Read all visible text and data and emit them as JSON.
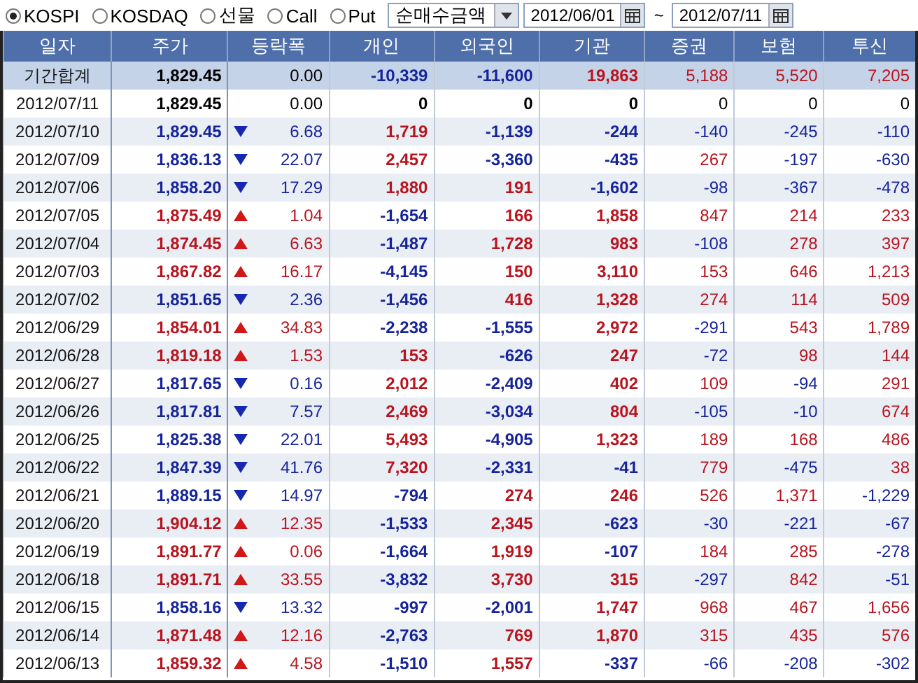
{
  "market_options": [
    {
      "label": "KOSPI",
      "selected": true
    },
    {
      "label": "KOSDAQ",
      "selected": false
    },
    {
      "label": "선물",
      "selected": false
    },
    {
      "label": "Call",
      "selected": false
    },
    {
      "label": "Put",
      "selected": false
    }
  ],
  "measure_dropdown": {
    "value": "순매수금액"
  },
  "date_from": {
    "value": "2012/06/01"
  },
  "range_separator": "~",
  "date_to": {
    "value": "2012/07/11"
  },
  "table": {
    "columns": [
      "일자",
      "주가",
      "등락폭",
      "개인",
      "외국인",
      "기관",
      "증권",
      "보험",
      "투신"
    ],
    "rows": [
      {
        "summary": true,
        "cells": [
          {
            "text": "기간합계"
          },
          {
            "text": "1,829.45",
            "color": "#000000"
          },
          {
            "text": "0.00",
            "color": "#000000",
            "rising": false,
            "falling": false
          },
          {
            "text": "-10,339",
            "color": "#16249a"
          },
          {
            "text": "-11,600",
            "color": "#16249a"
          },
          {
            "text": "19,863",
            "color": "#b8141e"
          },
          {
            "text": "5,188",
            "color": "#b8141e"
          },
          {
            "text": "5,520",
            "color": "#b8141e"
          },
          {
            "text": "7,205",
            "color": "#b8141e"
          }
        ]
      },
      {
        "summary": false,
        "cells": [
          {
            "text": "2012/07/11"
          },
          {
            "text": "1,829.45",
            "color": "#000000"
          },
          {
            "text": "0.00",
            "color": "#000000",
            "rising": false,
            "falling": false
          },
          {
            "text": "0",
            "color": "#000000"
          },
          {
            "text": "0",
            "color": "#000000"
          },
          {
            "text": "0",
            "color": "#000000"
          },
          {
            "text": "0",
            "color": "#000000"
          },
          {
            "text": "0",
            "color": "#000000"
          },
          {
            "text": "0",
            "color": "#000000"
          }
        ]
      },
      {
        "summary": false,
        "cells": [
          {
            "text": "2012/07/10"
          },
          {
            "text": "1,829.45",
            "color": "#16249a"
          },
          {
            "text": "6.68",
            "color": "#16249a",
            "rising": false,
            "falling": true
          },
          {
            "text": "1,719",
            "color": "#b8141e"
          },
          {
            "text": "-1,139",
            "color": "#16249a"
          },
          {
            "text": "-244",
            "color": "#16249a"
          },
          {
            "text": "-140",
            "color": "#16249a"
          },
          {
            "text": "-245",
            "color": "#16249a"
          },
          {
            "text": "-110",
            "color": "#16249a"
          }
        ]
      },
      {
        "summary": false,
        "cells": [
          {
            "text": "2012/07/09"
          },
          {
            "text": "1,836.13",
            "color": "#16249a"
          },
          {
            "text": "22.07",
            "color": "#16249a",
            "rising": false,
            "falling": true
          },
          {
            "text": "2,457",
            "color": "#b8141e"
          },
          {
            "text": "-3,360",
            "color": "#16249a"
          },
          {
            "text": "-435",
            "color": "#16249a"
          },
          {
            "text": "267",
            "color": "#b8141e"
          },
          {
            "text": "-197",
            "color": "#16249a"
          },
          {
            "text": "-630",
            "color": "#16249a"
          }
        ]
      },
      {
        "summary": false,
        "cells": [
          {
            "text": "2012/07/06"
          },
          {
            "text": "1,858.20",
            "color": "#16249a"
          },
          {
            "text": "17.29",
            "color": "#16249a",
            "rising": false,
            "falling": true
          },
          {
            "text": "1,880",
            "color": "#b8141e"
          },
          {
            "text": "191",
            "color": "#b8141e"
          },
          {
            "text": "-1,602",
            "color": "#16249a"
          },
          {
            "text": "-98",
            "color": "#16249a"
          },
          {
            "text": "-367",
            "color": "#16249a"
          },
          {
            "text": "-478",
            "color": "#16249a"
          }
        ]
      },
      {
        "summary": false,
        "cells": [
          {
            "text": "2012/07/05"
          },
          {
            "text": "1,875.49",
            "color": "#b8141e"
          },
          {
            "text": "1.04",
            "color": "#b8141e",
            "rising": true,
            "falling": false
          },
          {
            "text": "-1,654",
            "color": "#16249a"
          },
          {
            "text": "166",
            "color": "#b8141e"
          },
          {
            "text": "1,858",
            "color": "#b8141e"
          },
          {
            "text": "847",
            "color": "#b8141e"
          },
          {
            "text": "214",
            "color": "#b8141e"
          },
          {
            "text": "233",
            "color": "#b8141e"
          }
        ]
      },
      {
        "summary": false,
        "cells": [
          {
            "text": "2012/07/04"
          },
          {
            "text": "1,874.45",
            "color": "#b8141e"
          },
          {
            "text": "6.63",
            "color": "#b8141e",
            "rising": true,
            "falling": false
          },
          {
            "text": "-1,487",
            "color": "#16249a"
          },
          {
            "text": "1,728",
            "color": "#b8141e"
          },
          {
            "text": "983",
            "color": "#b8141e"
          },
          {
            "text": "-108",
            "color": "#16249a"
          },
          {
            "text": "278",
            "color": "#b8141e"
          },
          {
            "text": "397",
            "color": "#b8141e"
          }
        ]
      },
      {
        "summary": false,
        "cells": [
          {
            "text": "2012/07/03"
          },
          {
            "text": "1,867.82",
            "color": "#b8141e"
          },
          {
            "text": "16.17",
            "color": "#b8141e",
            "rising": true,
            "falling": false
          },
          {
            "text": "-4,145",
            "color": "#16249a"
          },
          {
            "text": "150",
            "color": "#b8141e"
          },
          {
            "text": "3,110",
            "color": "#b8141e"
          },
          {
            "text": "153",
            "color": "#b8141e"
          },
          {
            "text": "646",
            "color": "#b8141e"
          },
          {
            "text": "1,213",
            "color": "#b8141e"
          }
        ]
      },
      {
        "summary": false,
        "cells": [
          {
            "text": "2012/07/02"
          },
          {
            "text": "1,851.65",
            "color": "#16249a"
          },
          {
            "text": "2.36",
            "color": "#16249a",
            "rising": false,
            "falling": true
          },
          {
            "text": "-1,456",
            "color": "#16249a"
          },
          {
            "text": "416",
            "color": "#b8141e"
          },
          {
            "text": "1,328",
            "color": "#b8141e"
          },
          {
            "text": "274",
            "color": "#b8141e"
          },
          {
            "text": "114",
            "color": "#b8141e"
          },
          {
            "text": "509",
            "color": "#b8141e"
          }
        ]
      },
      {
        "summary": false,
        "cells": [
          {
            "text": "2012/06/29"
          },
          {
            "text": "1,854.01",
            "color": "#b8141e"
          },
          {
            "text": "34.83",
            "color": "#b8141e",
            "rising": true,
            "falling": false
          },
          {
            "text": "-2,238",
            "color": "#16249a"
          },
          {
            "text": "-1,555",
            "color": "#16249a"
          },
          {
            "text": "2,972",
            "color": "#b8141e"
          },
          {
            "text": "-291",
            "color": "#16249a"
          },
          {
            "text": "543",
            "color": "#b8141e"
          },
          {
            "text": "1,789",
            "color": "#b8141e"
          }
        ]
      },
      {
        "summary": false,
        "cells": [
          {
            "text": "2012/06/28"
          },
          {
            "text": "1,819.18",
            "color": "#b8141e"
          },
          {
            "text": "1.53",
            "color": "#b8141e",
            "rising": true,
            "falling": false
          },
          {
            "text": "153",
            "color": "#b8141e"
          },
          {
            "text": "-626",
            "color": "#16249a"
          },
          {
            "text": "247",
            "color": "#b8141e"
          },
          {
            "text": "-72",
            "color": "#16249a"
          },
          {
            "text": "98",
            "color": "#b8141e"
          },
          {
            "text": "144",
            "color": "#b8141e"
          }
        ]
      },
      {
        "summary": false,
        "cells": [
          {
            "text": "2012/06/27"
          },
          {
            "text": "1,817.65",
            "color": "#16249a"
          },
          {
            "text": "0.16",
            "color": "#16249a",
            "rising": false,
            "falling": true
          },
          {
            "text": "2,012",
            "color": "#b8141e"
          },
          {
            "text": "-2,409",
            "color": "#16249a"
          },
          {
            "text": "402",
            "color": "#b8141e"
          },
          {
            "text": "109",
            "color": "#b8141e"
          },
          {
            "text": "-94",
            "color": "#16249a"
          },
          {
            "text": "291",
            "color": "#b8141e"
          }
        ]
      },
      {
        "summary": false,
        "cells": [
          {
            "text": "2012/06/26"
          },
          {
            "text": "1,817.81",
            "color": "#16249a"
          },
          {
            "text": "7.57",
            "color": "#16249a",
            "rising": false,
            "falling": true
          },
          {
            "text": "2,469",
            "color": "#b8141e"
          },
          {
            "text": "-3,034",
            "color": "#16249a"
          },
          {
            "text": "804",
            "color": "#b8141e"
          },
          {
            "text": "-105",
            "color": "#16249a"
          },
          {
            "text": "-10",
            "color": "#16249a"
          },
          {
            "text": "674",
            "color": "#b8141e"
          }
        ]
      },
      {
        "summary": false,
        "cells": [
          {
            "text": "2012/06/25"
          },
          {
            "text": "1,825.38",
            "color": "#16249a"
          },
          {
            "text": "22.01",
            "color": "#16249a",
            "rising": false,
            "falling": true
          },
          {
            "text": "5,493",
            "color": "#b8141e"
          },
          {
            "text": "-4,905",
            "color": "#16249a"
          },
          {
            "text": "1,323",
            "color": "#b8141e"
          },
          {
            "text": "189",
            "color": "#b8141e"
          },
          {
            "text": "168",
            "color": "#b8141e"
          },
          {
            "text": "486",
            "color": "#b8141e"
          }
        ]
      },
      {
        "summary": false,
        "cells": [
          {
            "text": "2012/06/22"
          },
          {
            "text": "1,847.39",
            "color": "#16249a"
          },
          {
            "text": "41.76",
            "color": "#16249a",
            "rising": false,
            "falling": true
          },
          {
            "text": "7,320",
            "color": "#b8141e"
          },
          {
            "text": "-2,331",
            "color": "#16249a"
          },
          {
            "text": "-41",
            "color": "#16249a"
          },
          {
            "text": "779",
            "color": "#b8141e"
          },
          {
            "text": "-475",
            "color": "#16249a"
          },
          {
            "text": "38",
            "color": "#b8141e"
          }
        ]
      },
      {
        "summary": false,
        "cells": [
          {
            "text": "2012/06/21"
          },
          {
            "text": "1,889.15",
            "color": "#16249a"
          },
          {
            "text": "14.97",
            "color": "#16249a",
            "rising": false,
            "falling": true
          },
          {
            "text": "-794",
            "color": "#16249a"
          },
          {
            "text": "274",
            "color": "#b8141e"
          },
          {
            "text": "246",
            "color": "#b8141e"
          },
          {
            "text": "526",
            "color": "#b8141e"
          },
          {
            "text": "1,371",
            "color": "#b8141e"
          },
          {
            "text": "-1,229",
            "color": "#16249a"
          }
        ]
      },
      {
        "summary": false,
        "cells": [
          {
            "text": "2012/06/20"
          },
          {
            "text": "1,904.12",
            "color": "#b8141e"
          },
          {
            "text": "12.35",
            "color": "#b8141e",
            "rising": true,
            "falling": false
          },
          {
            "text": "-1,533",
            "color": "#16249a"
          },
          {
            "text": "2,345",
            "color": "#b8141e"
          },
          {
            "text": "-623",
            "color": "#16249a"
          },
          {
            "text": "-30",
            "color": "#16249a"
          },
          {
            "text": "-221",
            "color": "#16249a"
          },
          {
            "text": "-67",
            "color": "#16249a"
          }
        ]
      },
      {
        "summary": false,
        "cells": [
          {
            "text": "2012/06/19"
          },
          {
            "text": "1,891.77",
            "color": "#b8141e"
          },
          {
            "text": "0.06",
            "color": "#b8141e",
            "rising": true,
            "falling": false
          },
          {
            "text": "-1,664",
            "color": "#16249a"
          },
          {
            "text": "1,919",
            "color": "#b8141e"
          },
          {
            "text": "-107",
            "color": "#16249a"
          },
          {
            "text": "184",
            "color": "#b8141e"
          },
          {
            "text": "285",
            "color": "#b8141e"
          },
          {
            "text": "-278",
            "color": "#16249a"
          }
        ]
      },
      {
        "summary": false,
        "cells": [
          {
            "text": "2012/06/18"
          },
          {
            "text": "1,891.71",
            "color": "#b8141e"
          },
          {
            "text": "33.55",
            "color": "#b8141e",
            "rising": true,
            "falling": false
          },
          {
            "text": "-3,832",
            "color": "#16249a"
          },
          {
            "text": "3,730",
            "color": "#b8141e"
          },
          {
            "text": "315",
            "color": "#b8141e"
          },
          {
            "text": "-297",
            "color": "#16249a"
          },
          {
            "text": "842",
            "color": "#b8141e"
          },
          {
            "text": "-51",
            "color": "#16249a"
          }
        ]
      },
      {
        "summary": false,
        "cells": [
          {
            "text": "2012/06/15"
          },
          {
            "text": "1,858.16",
            "color": "#16249a"
          },
          {
            "text": "13.32",
            "color": "#16249a",
            "rising": false,
            "falling": true
          },
          {
            "text": "-997",
            "color": "#16249a"
          },
          {
            "text": "-2,001",
            "color": "#16249a"
          },
          {
            "text": "1,747",
            "color": "#b8141e"
          },
          {
            "text": "968",
            "color": "#b8141e"
          },
          {
            "text": "467",
            "color": "#b8141e"
          },
          {
            "text": "1,656",
            "color": "#b8141e"
          }
        ]
      },
      {
        "summary": false,
        "cells": [
          {
            "text": "2012/06/14"
          },
          {
            "text": "1,871.48",
            "color": "#b8141e"
          },
          {
            "text": "12.16",
            "color": "#b8141e",
            "rising": true,
            "falling": false
          },
          {
            "text": "-2,763",
            "color": "#16249a"
          },
          {
            "text": "769",
            "color": "#b8141e"
          },
          {
            "text": "1,870",
            "color": "#b8141e"
          },
          {
            "text": "315",
            "color": "#b8141e"
          },
          {
            "text": "435",
            "color": "#b8141e"
          },
          {
            "text": "576",
            "color": "#b8141e"
          }
        ]
      },
      {
        "summary": false,
        "cells": [
          {
            "text": "2012/06/13"
          },
          {
            "text": "1,859.32",
            "color": "#b8141e"
          },
          {
            "text": "4.58",
            "color": "#b8141e",
            "rising": true,
            "falling": false
          },
          {
            "text": "-1,510",
            "color": "#16249a"
          },
          {
            "text": "1,557",
            "color": "#b8141e"
          },
          {
            "text": "-337",
            "color": "#16249a"
          },
          {
            "text": "-66",
            "color": "#16249a"
          },
          {
            "text": "-208",
            "color": "#16249a"
          },
          {
            "text": "-302",
            "color": "#16249a"
          }
        ]
      }
    ]
  }
}
